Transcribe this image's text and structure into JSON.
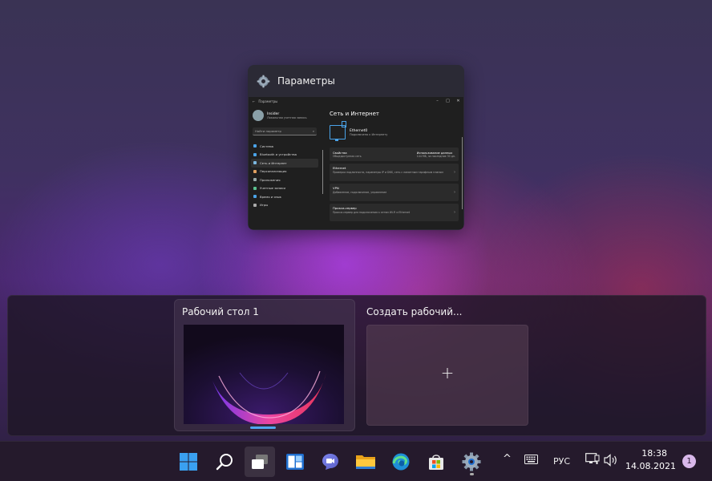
{
  "window_card": {
    "title": "Параметры",
    "thumb": {
      "app_title": "Параметры",
      "user_name": "Insider",
      "user_sub": "Локальная учетная запись",
      "search_placeholder": "Найти параметр",
      "nav": [
        {
          "label": "Система",
          "color": "#4aa3e8"
        },
        {
          "label": "Bluetooth и устройства",
          "color": "#4aa3e8"
        },
        {
          "label": "Сеть и Интернет",
          "color": "#7bb7e0"
        },
        {
          "label": "Персонализация",
          "color": "#e0a060"
        },
        {
          "label": "Приложения",
          "color": "#9aa"
        },
        {
          "label": "Учетные записи",
          "color": "#5ac18e"
        },
        {
          "label": "Время и язык",
          "color": "#4aa3e8"
        },
        {
          "label": "Игры",
          "color": "#aaa"
        }
      ],
      "heading": "Сеть и Интернет",
      "eth_name": "Ethernet0",
      "eth_status": "Подключено к Интернету",
      "props_label": "Свойства",
      "props_sub": "Общедоступная сеть",
      "usage_label": "Использование данных",
      "usage_value": "144 МБ, за последние 30 дн.",
      "rows": [
        {
          "title": "Ethernet",
          "sub": "Проверка подлинности, параметры IP и DNS, сеть с лимитным тарифным планом"
        },
        {
          "title": "VPN",
          "sub": "Добавление, подключение, управление"
        },
        {
          "title": "Прокси-сервер",
          "sub": "Прокси-сервер для подключения к сетям Wi-Fi и Ethernet"
        }
      ]
    }
  },
  "desktops": {
    "current_label": "Рабочий стол 1",
    "new_label": "Создать рабочий...",
    "plus": "+"
  },
  "taskbar": {
    "apps": [
      "start-icon",
      "search-icon",
      "task-view-icon",
      "widgets-icon",
      "chat-icon",
      "file-explorer-icon",
      "edge-icon",
      "store-icon",
      "settings-icon"
    ],
    "tray_chevron": "^",
    "language": "РУС",
    "time": "18:38",
    "date": "14.08.2021",
    "notifications": "1"
  },
  "colors": {
    "accent": "#4da6f0",
    "taskbar": "#251a2c"
  }
}
